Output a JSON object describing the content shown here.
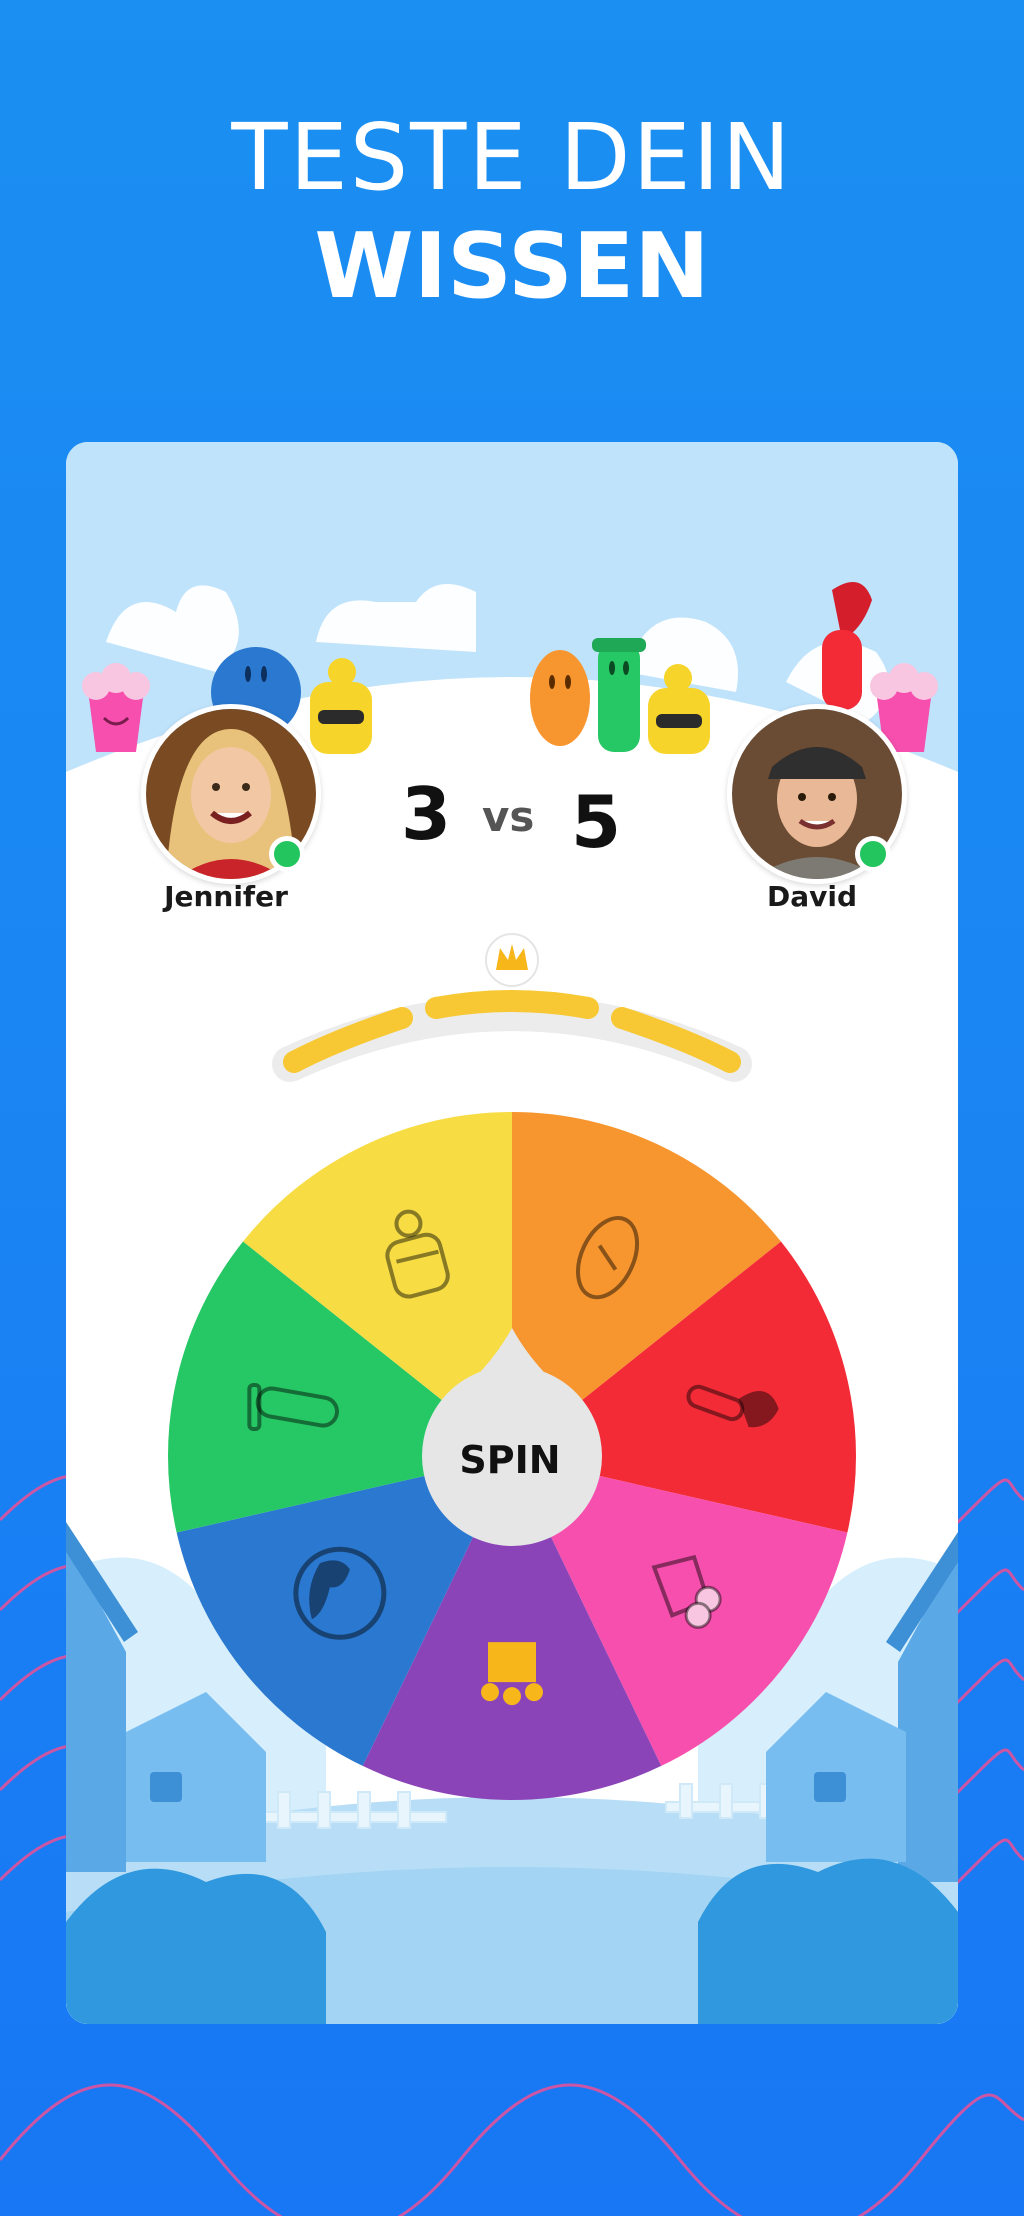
{
  "headline": {
    "line1": "TESTE DEIN",
    "line2": "WISSEN"
  },
  "match": {
    "player1": {
      "name": "Jennifer",
      "score": "3",
      "status": "online"
    },
    "player2": {
      "name": "David",
      "score": "5",
      "status": "online"
    },
    "vs_label": "vs"
  },
  "progress": {
    "segments_total": 3,
    "segments_filled": 3,
    "reward_icon": "crown-icon"
  },
  "wheel": {
    "spin_label": "SPIN",
    "categories": [
      {
        "name": "sports",
        "color": "#f7962f",
        "icon": "football-icon"
      },
      {
        "name": "art",
        "color": "#f22b37",
        "icon": "paintbrush-icon"
      },
      {
        "name": "entertainment",
        "color": "#f64fae",
        "icon": "popcorn-icon"
      },
      {
        "name": "crown",
        "color": "#8b44b8",
        "icon": "crown-icon"
      },
      {
        "name": "geography",
        "color": "#2a78cf",
        "icon": "globe-icon"
      },
      {
        "name": "science",
        "color": "#26c765",
        "icon": "test-tube-icon"
      },
      {
        "name": "history",
        "color": "#f7dc44",
        "icon": "knight-helmet-icon"
      }
    ]
  },
  "colors": {
    "background": "#1a86f3",
    "accent_yellow": "#f7c833",
    "online": "#22c55e",
    "wave": "#e0529c"
  }
}
